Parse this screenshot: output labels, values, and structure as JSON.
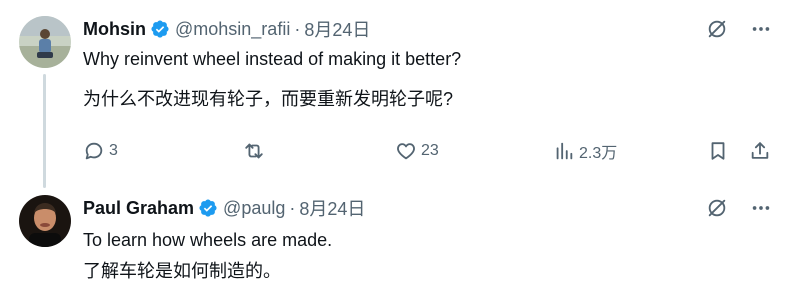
{
  "tweets": [
    {
      "author_name": "Mohsin",
      "handle": "@mohsin_rafii",
      "separator": "·",
      "date": "8月24日",
      "text_en": "Why reinvent wheel instead of making it better?",
      "text_zh": "为什么不改进现有轮子，而要重新发明轮子呢?",
      "stats": {
        "replies": "3",
        "likes": "23",
        "views": "2.3万"
      }
    },
    {
      "author_name": "Paul Graham",
      "handle": "@paulg",
      "separator": "·",
      "date": "8月24日",
      "text_en": "To learn how wheels are made.",
      "text_zh": "了解车轮是如何制造的。"
    }
  ],
  "colors": {
    "verified": "#1d9bf0",
    "muted_text": "#536471",
    "thread_line": "#cfd9de",
    "text": "#0f1419"
  },
  "icons": [
    "verified-badge-icon",
    "grok-icon",
    "more-icon",
    "reply-icon",
    "retweet-icon",
    "like-icon",
    "views-icon",
    "bookmark-icon",
    "share-icon"
  ]
}
